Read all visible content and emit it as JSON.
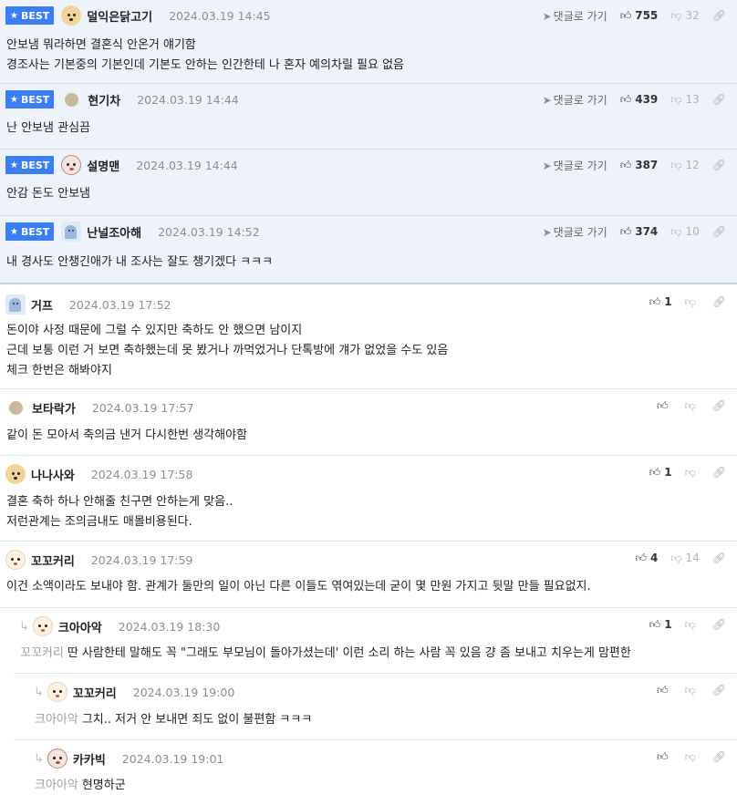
{
  "best_label": "BEST",
  "reply_label": "댓글로 가기",
  "comments": [
    {
      "nick": "덜익은닭고기",
      "date": "2024.03.19 14:45",
      "likes": "755",
      "dislikes": "32",
      "lines": [
        "안보냄 뭐라하면 결혼식 안온거 얘기함",
        "경조사는 기본중의 기본인데 기본도 안하는 인간한테 나 혼자 예의차릴 필요 없음"
      ]
    },
    {
      "nick": "현기차",
      "date": "2024.03.19 14:44",
      "likes": "439",
      "dislikes": "13",
      "lines": [
        "난 안보냄 관심끔"
      ]
    },
    {
      "nick": "설명맨",
      "date": "2024.03.19 14:44",
      "likes": "387",
      "dislikes": "12",
      "lines": [
        "안감 돈도 안보냄"
      ]
    },
    {
      "nick": "난널조아해",
      "date": "2024.03.19 14:52",
      "likes": "374",
      "dislikes": "10",
      "lines": [
        "내 경사도 안챙긴애가 내 조사는 잘도 챙기겠다 ㅋㅋㅋ"
      ]
    },
    {
      "nick": "거프",
      "date": "2024.03.19 17:52",
      "likes": "1",
      "dislikes": "",
      "lines": [
        "돈이야 사정 때문에 그럴 수 있지만 축하도 안 했으면 남이지",
        "근데 보통 이런 거 보면 축하했는데 못 봤거나 까먹었거나 단톡방에 걔가 없었을 수도 있음",
        "체크 한번은 해봐야지"
      ]
    },
    {
      "nick": "보타락가",
      "date": "2024.03.19 17:57",
      "likes": "",
      "dislikes": "",
      "lines": [
        "같이 돈 모아서 축의금 낸거 다시한번 생각해야함"
      ]
    },
    {
      "nick": "나나사와",
      "date": "2024.03.19 17:58",
      "likes": "1",
      "dislikes": "",
      "lines": [
        "결혼 축하 하나 안해줄 친구면 안하는게 맞음..",
        "저런관계는 조의금내도 매몰비용된다."
      ]
    },
    {
      "nick": "꼬꼬커리",
      "date": "2024.03.19 17:59",
      "likes": "4",
      "dislikes": "14",
      "lines": [
        "이건 소액이라도 보내야 함. 관계가 둘만의 일이 아닌 다른 이들도 엮여있는데 굳이 몇 만원 가지고 뒷말 만들 필요없지."
      ]
    },
    {
      "nick": "크아아악",
      "date": "2024.03.19 18:30",
      "likes": "1",
      "dislikes": "",
      "mention": "꼬꼬커리",
      "lines": [
        "딴 사람한테 말해도 꼭 \"그래도 부모님이 돌아가셨는데' 이런 소리 하는 사람 꼭 있음 걍 좀 보내고 치우는게 맘편한"
      ]
    },
    {
      "nick": "꼬꼬커리",
      "date": "2024.03.19 19:00",
      "likes": "",
      "dislikes": "",
      "mention": "크아아악",
      "lines": [
        "그치.. 저거 안 보내면 죄도 없이 불편함 ㅋㅋㅋ"
      ]
    },
    {
      "nick": "카카빅",
      "date": "2024.03.19 19:01",
      "likes": "",
      "dislikes": "",
      "mention": "크아아악",
      "lines": [
        "현명하군"
      ]
    }
  ]
}
